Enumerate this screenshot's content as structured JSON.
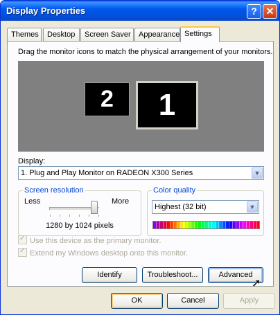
{
  "window": {
    "title": "Display Properties",
    "help_glyph": "?",
    "close_glyph": "✕"
  },
  "tabs": [
    {
      "label": "Themes"
    },
    {
      "label": "Desktop"
    },
    {
      "label": "Screen Saver"
    },
    {
      "label": "Appearance"
    },
    {
      "label": "Settings",
      "active": true
    }
  ],
  "settings": {
    "instruction": "Drag the monitor icons to match the physical arrangement of your monitors.",
    "monitors": [
      {
        "number": "2"
      },
      {
        "number": "1",
        "selected": true
      }
    ],
    "display_label": "Display:",
    "display_value": "1. Plug and Play Monitor on RADEON X300 Series",
    "resolution": {
      "title": "Screen resolution",
      "less": "Less",
      "more": "More",
      "value_text": "1280 by 1024 pixels",
      "slider_position": 1.0
    },
    "color_quality": {
      "title": "Color quality",
      "value": "Highest (32 bit)"
    },
    "checkboxes": [
      {
        "label": "Use this device as the primary monitor.",
        "checked": true,
        "enabled": false
      },
      {
        "label": "Extend my Windows desktop onto this monitor.",
        "checked": true,
        "enabled": false
      }
    ],
    "buttons": {
      "identify": "Identify",
      "troubleshoot": "Troubleshoot...",
      "advanced": "Advanced"
    }
  },
  "dialog_buttons": {
    "ok": "OK",
    "cancel": "Cancel",
    "apply": "Apply"
  },
  "colors": {
    "titlebar": "#0054e3",
    "group_title": "#0046d5",
    "monitor_area": "#808080"
  }
}
